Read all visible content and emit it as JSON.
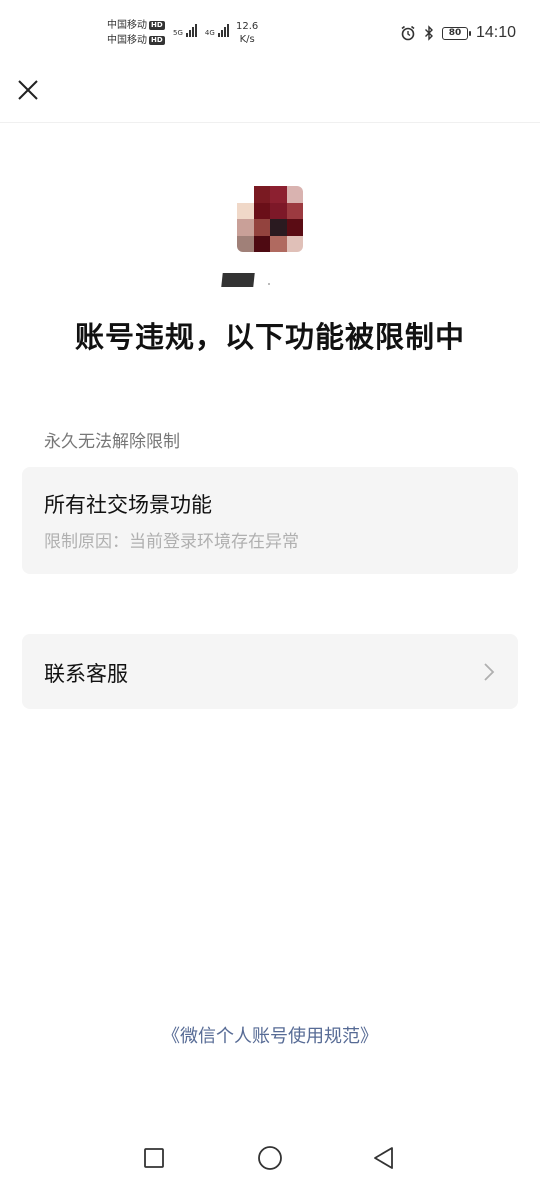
{
  "status_bar": {
    "carrier_1": "中国移动",
    "carrier_2": "中国移动",
    "hd_badge": "HD",
    "net_1": "5G",
    "net_2": "4G",
    "speed_value": "12.6",
    "speed_unit": "K/s",
    "battery_level": "80",
    "time": "14:10"
  },
  "header": {
    "close_icon": "close-icon"
  },
  "profile": {
    "avatar_icon": "pixelated-avatar"
  },
  "page": {
    "title": "账号违规，以下功能被限制中",
    "section_label": "永久无法解除限制",
    "restriction": {
      "title": "所有社交场景功能",
      "reason": "限制原因：当前登录环境存在异常"
    },
    "support": {
      "label": "联系客服",
      "icon": "chevron-right-icon"
    },
    "rules_link": "《微信个人账号使用规范》"
  },
  "system_nav": {
    "recent_icon": "square-icon",
    "home_icon": "circle-icon",
    "back_icon": "triangle-back-icon"
  },
  "colors": {
    "link": "#576b95",
    "card_bg": "#f5f5f5",
    "secondary_text": "#777777"
  }
}
